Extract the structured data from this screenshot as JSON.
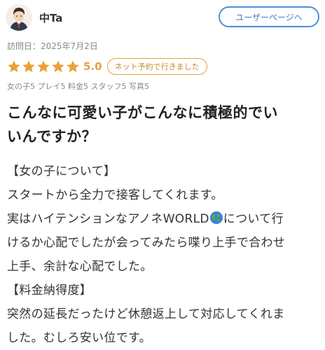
{
  "user": {
    "name": "中Ta",
    "profile_button": "ユーザーページへ"
  },
  "visit": {
    "text": "訪問日：2025年7月2日"
  },
  "rating": {
    "stars": 5,
    "max_stars": 5,
    "score": "5.0",
    "badge": "ネット予約で行きました",
    "star_color": "#e8a13a"
  },
  "subscores": {
    "text": "女の子5 プレイ5 料金5 スタッフ5 写真5"
  },
  "review": {
    "title_line1": "こんなに可愛い子がこんなに積極的でい",
    "title_line2": "いんですか？",
    "lines": {
      "l1": "【女の子について】",
      "l2": "スタートから全力で接客してくれます。",
      "l3_before": "実はハイテンションなアノネWORLD",
      "l3_icon": "globe-emoji",
      "l3_after": "について行",
      "l4": "けるか心配でしたが会ってみたら喋り上手で合わせ",
      "l5": "上手、余計な心配でした。",
      "l6": "【料金納得度】",
      "l7": "突然の延長だったけど休憩返上して対応してくれま",
      "l8": "した。むしろ安い位です。"
    }
  },
  "colors": {
    "accent_blue": "#4a90d9",
    "accent_orange": "#e8a13a"
  }
}
